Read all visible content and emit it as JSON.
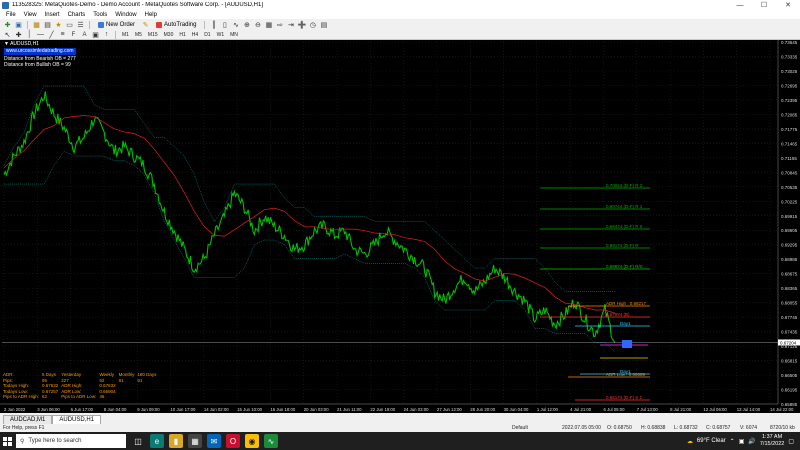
{
  "window": {
    "title": "113528325: MetaQuotes-Demo - Demo Account - MetaQuotes Software Corp. - [AUDUSD,H1]"
  },
  "menu": [
    "File",
    "View",
    "Insert",
    "Charts",
    "Tools",
    "Window",
    "Help"
  ],
  "toolbar": {
    "new_order": "New Order",
    "auto_trading": "AutoTrading",
    "timeframes": [
      "M1",
      "M5",
      "M15",
      "M30",
      "H1",
      "H4",
      "D1",
      "W1",
      "MN"
    ]
  },
  "chart": {
    "symbol_label": "AUDUSD,H1",
    "link": "www.urcossimledatrading.com",
    "bearish_ob": "Distance from Bearish OB = 277",
    "bullish_ob": "Distance from Bullish OB = 99",
    "current_price": "0.67204",
    "price_ticks": [
      "0.73645",
      "0.73335",
      "0.73025",
      "0.72695",
      "0.72395",
      "0.72085",
      "0.71775",
      "0.71465",
      "0.71155",
      "0.70845",
      "0.70535",
      "0.70225",
      "0.69915",
      "0.69605",
      "0.69295",
      "0.68985",
      "0.68675",
      "0.68365",
      "0.68055",
      "0.67745",
      "0.67435",
      "0.67125",
      "0.66815",
      "0.66505",
      "0.66195",
      "0.65885"
    ],
    "time_ticks": [
      "2 Jun 2022",
      "3 Jun 06:00",
      "6 Jun 17:00",
      "8 Jun 04:00",
      "9 Jun 09:00",
      "10 Jun 17:00",
      "14 Jun 02:00",
      "15 Jun 10:00",
      "16 Jun 18:00",
      "20 Jun 03:00",
      "21 Jun 11:00",
      "22 Jun 19:00",
      "24 Jun 03:00",
      "27 Jun 12:00",
      "28 Jun 20:00",
      "30 Jun 04:00",
      "1 Jul 12:00",
      "4 Jul 21:00",
      "6 Jul 05:00",
      "7 Jul 13:00",
      "8 Jul 21:00",
      "12 Jul 06:00",
      "13 Jul 14:00",
      "14 Jul 22:00"
    ],
    "level_labels": [
      {
        "text": "0.70044 (D-F) R 2",
        "color": "#00aa00"
      },
      {
        "text": "0.69744 (D-F) R 1",
        "color": "#00aa00"
      },
      {
        "text": "0.69474 (D-F) R 0",
        "color": "#00aa00"
      },
      {
        "text": "0.69174 (D-F) R",
        "color": "#00aa00"
      },
      {
        "text": "0.68874 (D-F) R/S",
        "color": "#00cc00"
      },
      {
        "text": "ADR High : 0.68217",
        "color": "#ff8800"
      },
      {
        "text": "0.67974 (B)",
        "color": "#ff3333"
      },
      {
        "text": "Day1",
        "color": "#33ccff"
      },
      {
        "text": "ADR Low : 0.66689",
        "color": "#ff8800"
      },
      {
        "text": "0.66174 (D-F) S 2",
        "color": "#ff3333"
      },
      {
        "text": "Day1",
        "color": "#33ccff"
      }
    ],
    "colors": {
      "price": "#00c000",
      "ma_red": "#e02020",
      "channel": "#00aaaa"
    }
  },
  "chart_data": {
    "type": "line",
    "series": [
      {
        "name": "",
        "values": [
          0.708,
          0.712,
          0.715,
          0.721,
          0.725,
          0.721,
          0.718,
          0.714,
          0.716,
          0.72,
          0.717,
          0.713,
          0.714,
          0.712,
          0.71,
          0.706,
          0.7,
          0.696,
          0.692,
          0.688,
          0.69,
          0.695,
          0.699,
          0.704,
          0.701,
          0.696,
          0.699,
          0.697,
          0.695,
          0.692,
          0.693,
          0.696,
          0.697,
          0.695,
          0.696,
          0.692,
          0.691,
          0.693,
          0.696,
          0.694,
          0.692,
          0.69,
          0.688,
          0.683,
          0.681,
          0.684,
          0.686,
          0.683,
          0.685,
          0.688,
          0.686,
          0.683,
          0.681,
          0.677,
          0.679,
          0.676,
          0.678,
          0.681,
          0.677,
          0.674,
          0.679,
          0.672
        ]
      }
    ],
    "ylim": [
      0.65885,
      0.73645
    ]
  }
}
